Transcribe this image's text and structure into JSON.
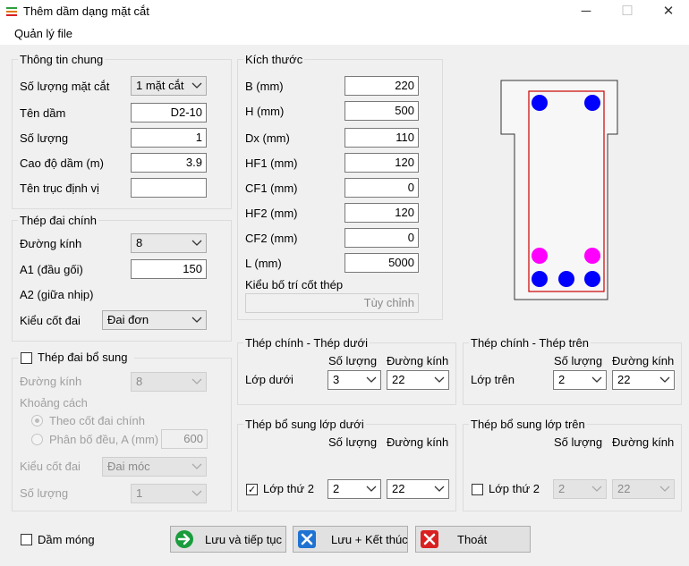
{
  "window": {
    "title": "Thêm dầm dạng mặt cắt",
    "minimize": "─",
    "maximize": "☐",
    "close": "✕"
  },
  "menu": {
    "file": "Quản lý file"
  },
  "general": {
    "title": "Thông tin chung",
    "section_count_label": "Số lượng mặt cắt",
    "section_count_value": "1 mặt cắt",
    "beam_name_label": "Tên dầm",
    "beam_name_value": "D2-10",
    "quantity_label": "Số lượng",
    "quantity_value": "1",
    "elevation_label": "Cao độ dầm (m)",
    "elevation_value": "3.9",
    "axis_label": "Tên trục định vị",
    "axis_value": ""
  },
  "main_stirrup": {
    "title": "Thép đai chính",
    "diameter_label": "Đường kính",
    "diameter_value": "8",
    "a1_label": "A1 (đầu gối)",
    "a1_value": "150",
    "a2_label": "A2 (giữa nhịp)",
    "type_label": "Kiểu cốt đai",
    "type_value": "Đai đơn"
  },
  "extra_stirrup": {
    "title": "Thép đai bổ sung",
    "checked": false,
    "diameter_label": "Đường kính",
    "diameter_value": "8",
    "spacing_label": "Khoảng cách",
    "option1_label": "Theo cốt đai chính",
    "option2_label": "Phân bố đều, A (mm)",
    "option2_value": "600",
    "type_label": "Kiểu cốt đai",
    "type_value": "Đai móc",
    "count_label": "Số lượng",
    "count_value": "1"
  },
  "dimensions": {
    "title": "Kích thước",
    "rows": [
      {
        "label": "B (mm)",
        "value": "220"
      },
      {
        "label": "H (mm)",
        "value": "500"
      },
      {
        "label": "Dx (mm)",
        "value": "110"
      },
      {
        "label": "HF1 (mm)",
        "value": "120"
      },
      {
        "label": "CF1 (mm)",
        "value": "0"
      },
      {
        "label": "HF2 (mm)",
        "value": "120"
      },
      {
        "label": "CF2 (mm)",
        "value": "0"
      },
      {
        "label": "L (mm)",
        "value": "5000"
      }
    ],
    "layout_label": "Kiểu bố trí cốt thép",
    "layout_value": "Tùy chỉnh"
  },
  "main_bottom": {
    "title": "Thép chính - Thép dưới",
    "count_header": "Số lượng",
    "diameter_header": "Đường kính",
    "row_label": "Lớp dưới",
    "count_value": "3",
    "diameter_value": "22"
  },
  "main_top": {
    "title": "Thép chính - Thép trên",
    "count_header": "Số lượng",
    "diameter_header": "Đường kính",
    "row_label": "Lớp trên",
    "count_value": "2",
    "diameter_value": "22"
  },
  "extra_bottom": {
    "title": "Thép bổ sung lớp dưới",
    "count_header": "Số lượng",
    "diameter_header": "Đường kính",
    "row_label": "Lớp thứ 2",
    "checked": true,
    "count_value": "2",
    "diameter_value": "22"
  },
  "extra_top": {
    "title": "Thép bổ sung lớp trên",
    "count_header": "Số lượng",
    "diameter_header": "Đường kính",
    "row_label": "Lớp thứ 2",
    "checked": false,
    "count_value": "2",
    "diameter_value": "22"
  },
  "footer": {
    "foundation_label": "Dầm móng",
    "foundation_checked": false,
    "save_continue": "Lưu và tiếp tục",
    "save_finish": "Lưu + Kết thúc",
    "exit": "Thoát"
  },
  "colors": {
    "main_rebar": "#0000ff",
    "extra_rebar": "#ff00ff",
    "stirrup": "#cc0000",
    "accent_green": "#1a9c3c",
    "accent_blue": "#1e73d2",
    "accent_red": "#d92020"
  }
}
